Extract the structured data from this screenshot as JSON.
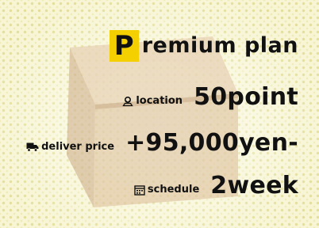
{
  "title": {
    "badge_letter": "P",
    "rest": "remium plan",
    "badge_color": "#f5d000"
  },
  "rows": [
    {
      "icon": "map-pin-icon",
      "label": "location",
      "value": "50point"
    },
    {
      "icon": "truck-icon",
      "label": "deliver price",
      "value": "+95,000yen-"
    },
    {
      "icon": "calendar-icon",
      "label": "schedule",
      "value": "2week"
    }
  ],
  "colors": {
    "background": "#f7f5d4",
    "dots": "#d6ce6e",
    "text": "#111111",
    "box": "#dfc3a0"
  }
}
